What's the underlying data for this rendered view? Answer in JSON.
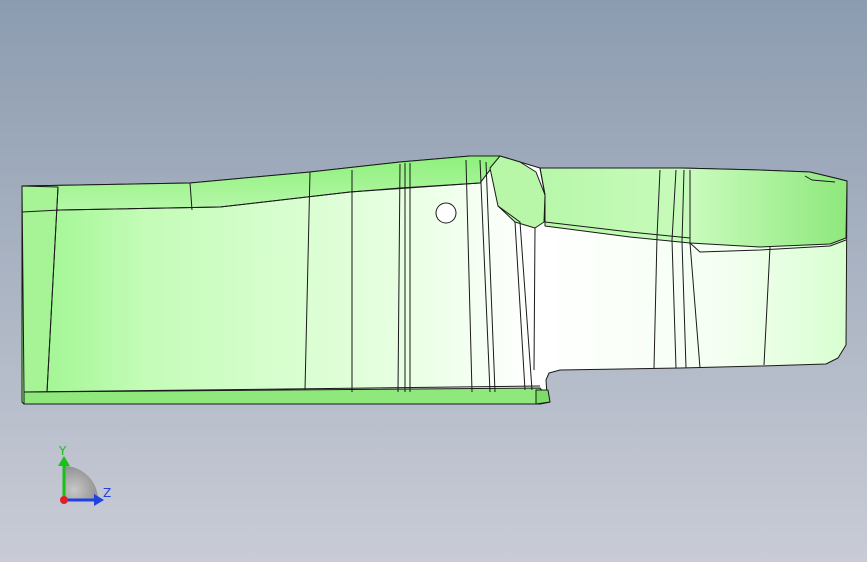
{
  "viewport": {
    "background_top": "#8c9cb0",
    "background_bottom": "#c9ccd6"
  },
  "part": {
    "fill_light": "#ffffff",
    "fill_mid": "#d8ffcf",
    "fill_green": "#9cf58c",
    "edge": "#1a1a1a"
  },
  "triad": {
    "y_label": "Y",
    "z_label": "Z",
    "y_color": "#18c018",
    "z_color": "#2040e0",
    "x_color": "#e02020"
  }
}
